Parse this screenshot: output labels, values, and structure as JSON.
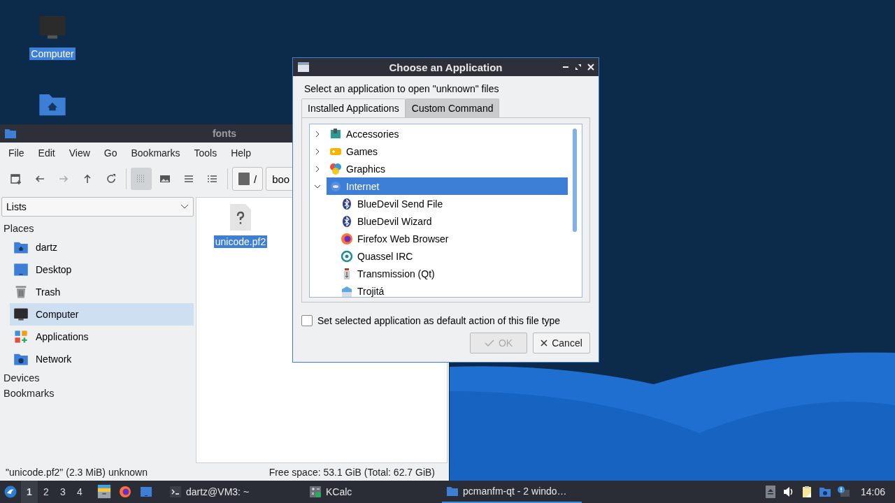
{
  "desktop_icons": [
    {
      "kind": "computer",
      "label": "Computer",
      "selected": true
    },
    {
      "kind": "home"
    }
  ],
  "file_manager": {
    "title": "fonts",
    "menu": [
      "File",
      "Edit",
      "View",
      "Go",
      "Bookmarks",
      "Tools",
      "Help"
    ],
    "toolbar": [
      {
        "kind": "new-tab",
        "selected": false
      },
      {
        "kind": "back",
        "selected": false
      },
      {
        "kind": "forward",
        "selected": false
      },
      {
        "kind": "up",
        "selected": false
      },
      {
        "kind": "reload",
        "selected": false
      },
      {
        "kind": "grid",
        "selected": true
      },
      {
        "kind": "thumbnail",
        "selected": false
      },
      {
        "kind": "compact",
        "selected": false
      },
      {
        "kind": "detail",
        "selected": false
      }
    ],
    "path": [
      {
        "kind": "root",
        "label": "/"
      },
      {
        "kind": "dir",
        "label": "boo"
      }
    ],
    "sidebar": {
      "dropdown": "Lists",
      "sections": [
        {
          "label": "Places",
          "items": [
            {
              "kind": "home",
              "label": "dartz",
              "selected": false
            },
            {
              "kind": "desktop",
              "label": "Desktop",
              "selected": false
            },
            {
              "kind": "trash",
              "label": "Trash",
              "selected": false
            },
            {
              "kind": "computer",
              "label": "Computer",
              "selected": true
            },
            {
              "kind": "apps",
              "label": "Applications",
              "selected": false
            },
            {
              "kind": "network",
              "label": "Network",
              "selected": false
            }
          ]
        },
        {
          "label": "Devices"
        },
        {
          "label": "Bookmarks"
        }
      ]
    },
    "files": [
      {
        "name": "unicode.pf2",
        "selected": true
      }
    ],
    "status": {
      "selection": "\"unicode.pf2\" (2.3 MiB) unknown",
      "free_space": "Free space: 53.1 GiB (Total: 62.7 GiB)"
    }
  },
  "dialog": {
    "title": "Choose an Application",
    "prompt": "Select an application to open \"unknown\" files",
    "tabs": [
      {
        "label": "Installed Applications",
        "selected": true
      },
      {
        "label": "Custom Command",
        "selected": false
      }
    ],
    "tree": [
      {
        "kind": "accessories",
        "label": "Accessories",
        "expanded": false,
        "selected": false
      },
      {
        "kind": "games",
        "label": "Games",
        "expanded": false,
        "selected": false
      },
      {
        "kind": "graphics",
        "label": "Graphics",
        "expanded": false,
        "selected": false
      },
      {
        "kind": "internet",
        "label": "Internet",
        "expanded": true,
        "selected": true,
        "children": [
          {
            "kind": "bluetooth",
            "label": "BlueDevil Send File",
            "selected": false
          },
          {
            "kind": "bluetooth",
            "label": "BlueDevil Wizard",
            "selected": false
          },
          {
            "kind": "firefox",
            "label": "Firefox Web Browser",
            "selected": false
          },
          {
            "kind": "quassel",
            "label": "Quassel IRC",
            "selected": false
          },
          {
            "kind": "transmission",
            "label": "Transmission (Qt)",
            "selected": false
          },
          {
            "kind": "mail",
            "label": "Trojitá",
            "selected": false
          }
        ]
      }
    ],
    "default_checkbox": {
      "label": "Set selected application as default action of this file type",
      "checked": false
    },
    "buttons": [
      {
        "kind": "ok",
        "label": "OK",
        "disabled": true
      },
      {
        "kind": "cancel",
        "label": "Cancel",
        "disabled": false
      }
    ]
  },
  "taskbar": {
    "workspaces": [
      {
        "label": "1",
        "selected": true
      },
      {
        "label": "2",
        "selected": false
      },
      {
        "label": "3",
        "selected": false
      },
      {
        "label": "4",
        "selected": false
      }
    ],
    "launchers": [
      {
        "kind": "files"
      },
      {
        "kind": "firefox"
      },
      {
        "kind": "desktop"
      }
    ],
    "tasks": [
      {
        "kind": "terminal",
        "label": "dartz@VM3: ~",
        "selected": false
      },
      {
        "kind": "calc",
        "label": "KCalc",
        "selected": false
      },
      {
        "kind": "folder",
        "label": "pcmanfm-qt - 2 windo…",
        "selected": true
      }
    ],
    "tray": [
      {
        "kind": "eject"
      },
      {
        "kind": "volume"
      },
      {
        "kind": "clipboard"
      },
      {
        "kind": "network"
      },
      {
        "kind": "update"
      }
    ],
    "clock": "14:06"
  }
}
